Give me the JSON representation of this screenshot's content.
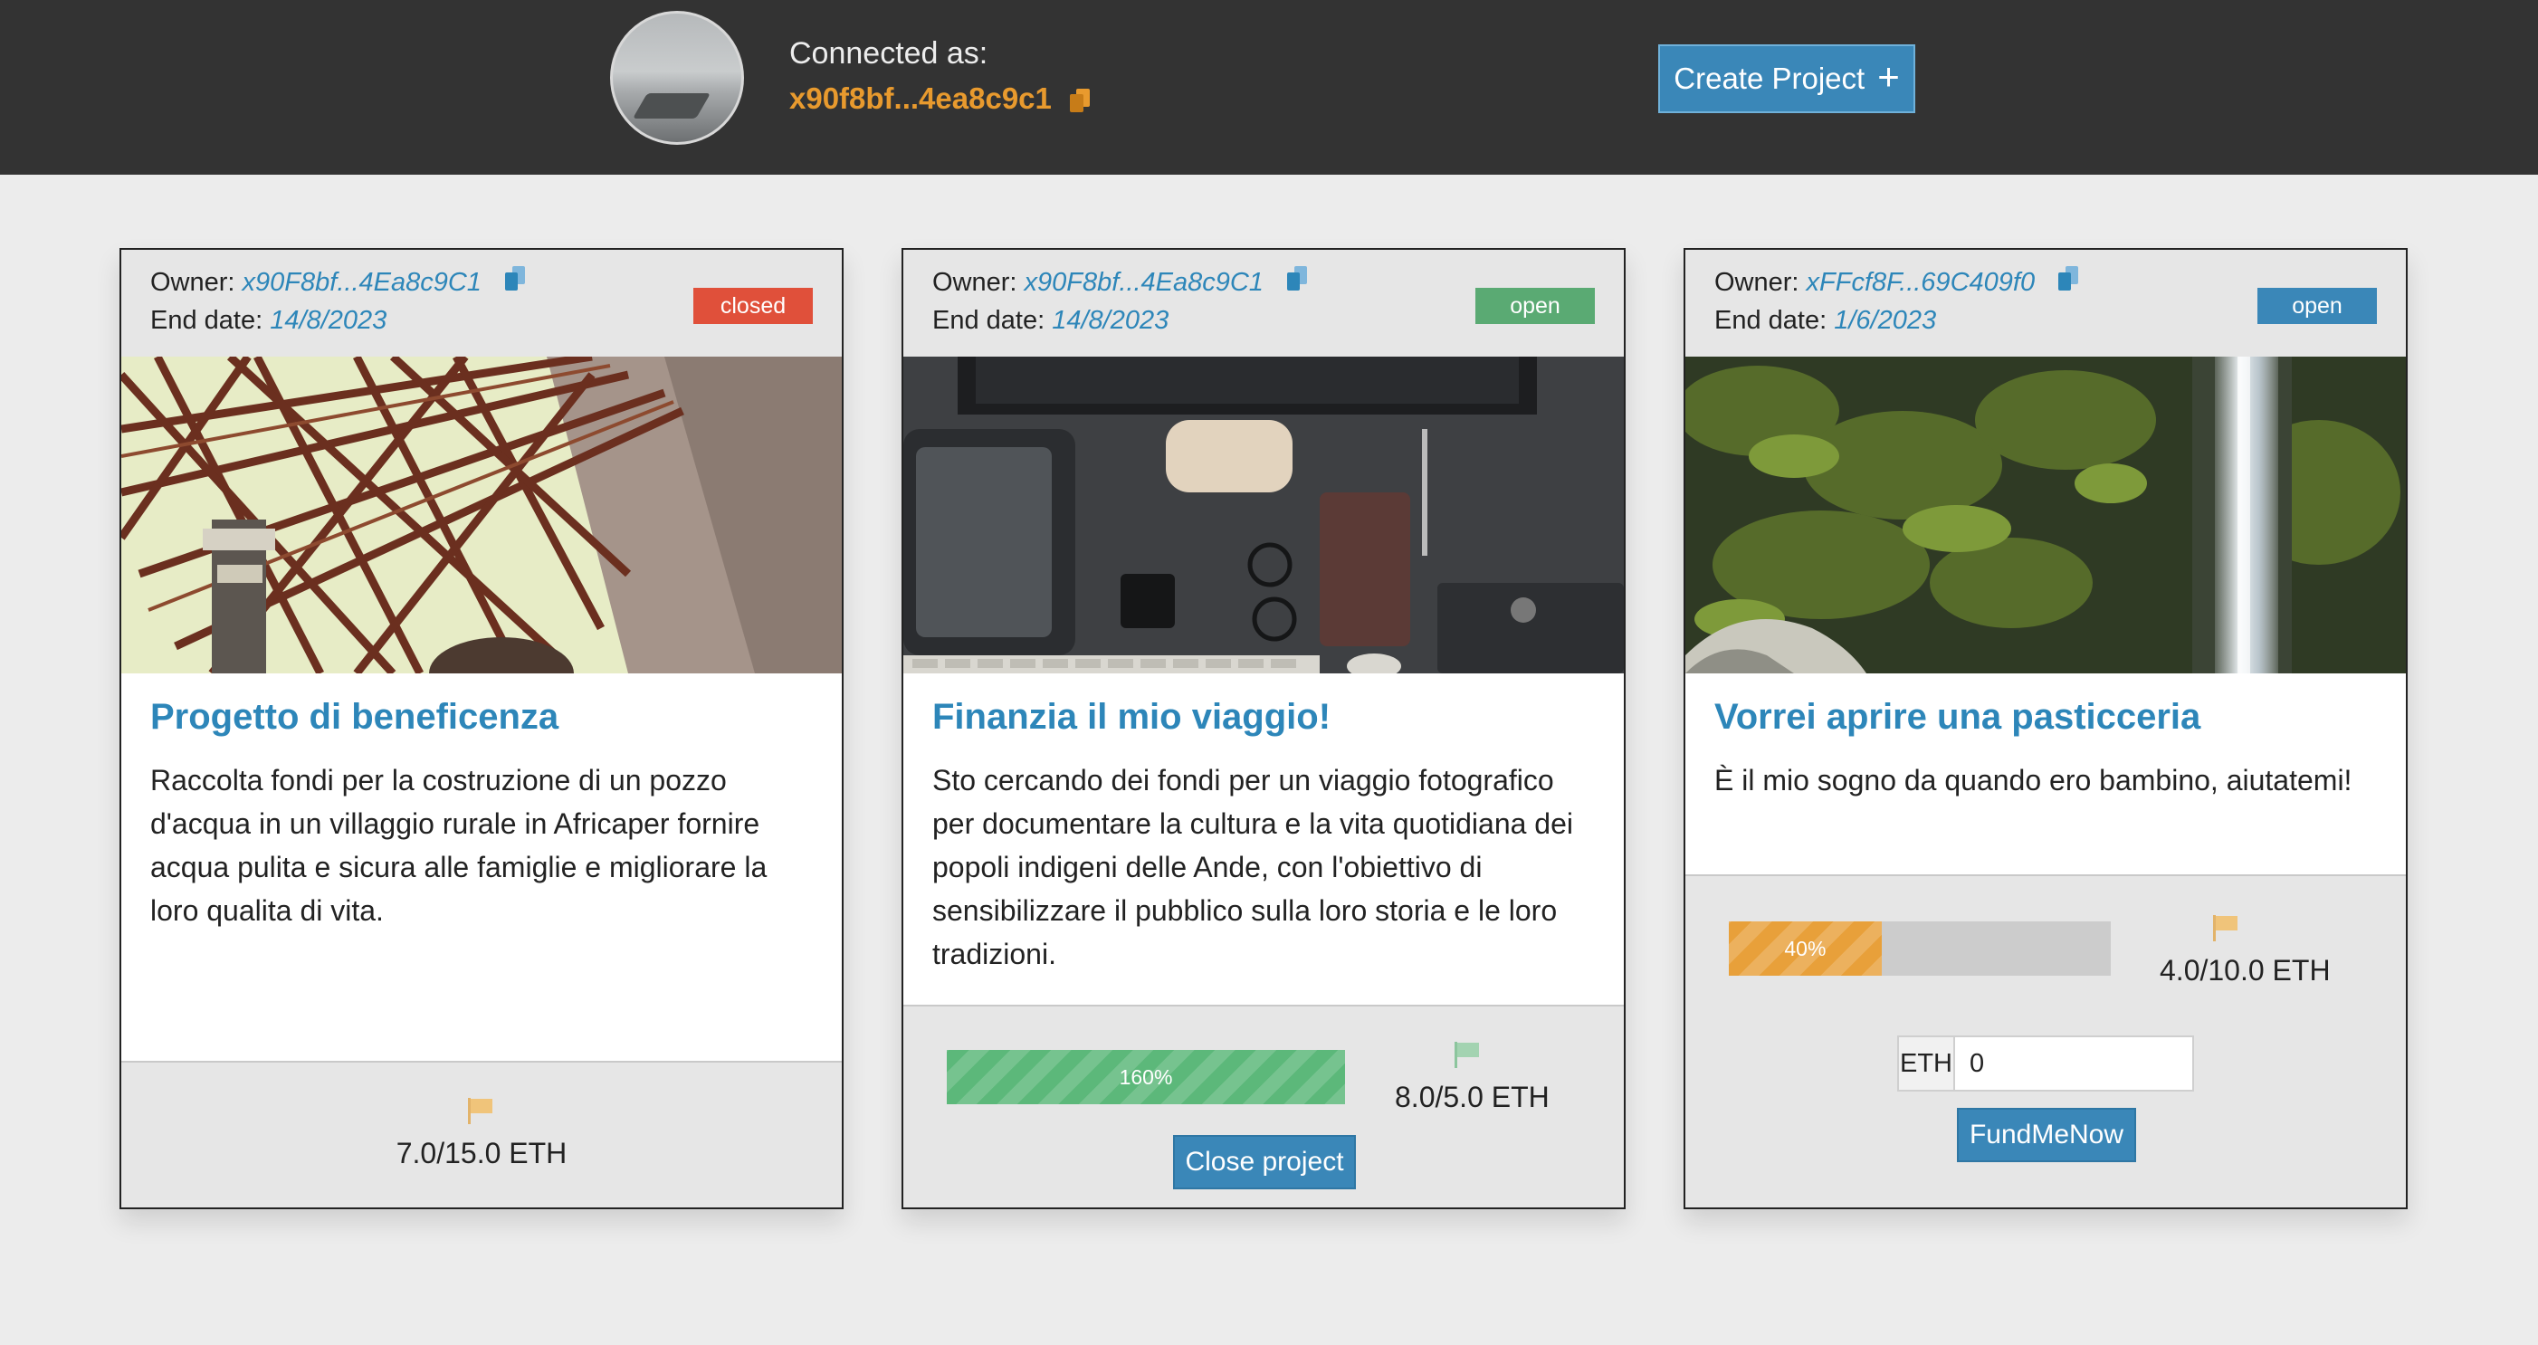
{
  "header": {
    "connected_label": "Connected as:",
    "address": "x90f8bf...4ea8c9c1",
    "create_button_label": "Create Project",
    "create_button_icon": "plus-icon"
  },
  "colors": {
    "header_bg": "#333333",
    "accent_blue": "#3a87b8",
    "accent_orange": "#e89a2e",
    "status_closed": "#e0503a",
    "status_open_green": "#5aaa73",
    "status_open_blue": "#3a87b8"
  },
  "projects": [
    {
      "owner_label": "Owner:",
      "owner": "x90F8bf...4Ea8c9C1",
      "end_label": "End date:",
      "end_date": "14/8/2023",
      "status": "closed",
      "title": "Progetto di beneficenza",
      "description": "Raccolta fondi per la costruzione di un pozzo d'acqua in un villaggio rurale in Africaper fornire acqua pulita e sicura alle famiglie e migliorare la loro qualita di vita.",
      "amount": "7.0/15.0 ETH"
    },
    {
      "owner_label": "Owner:",
      "owner": "x90F8bf...4Ea8c9C1",
      "end_label": "End date:",
      "end_date": "14/8/2023",
      "status": "open",
      "title": "Finanzia il mio viaggio!",
      "description": "Sto cercando dei fondi per un viaggio fotografico per documentare la cultura e la vita quotidiana dei popoli indigeni delle Ande, con l'obiettivo di sensibilizzare il pubblico sulla loro storia e le loro tradizioni.",
      "progress": 1.6,
      "progress_label": "160%",
      "amount": "8.0/5.0 ETH",
      "close_button_label": "Close project"
    },
    {
      "owner_label": "Owner:",
      "owner": "xFFcf8F...69C409f0",
      "end_label": "End date:",
      "end_date": "1/6/2023",
      "status": "open",
      "title": "Vorrei aprire una pasticceria",
      "description": "È il mio sogno da quando ero bambino, aiutatemi!",
      "progress": 0.4,
      "progress_label": "40%",
      "amount": "4.0/10.0 ETH",
      "input_addon": "ETH",
      "input_value": "0",
      "fund_button_label": "FundMeNow"
    }
  ]
}
